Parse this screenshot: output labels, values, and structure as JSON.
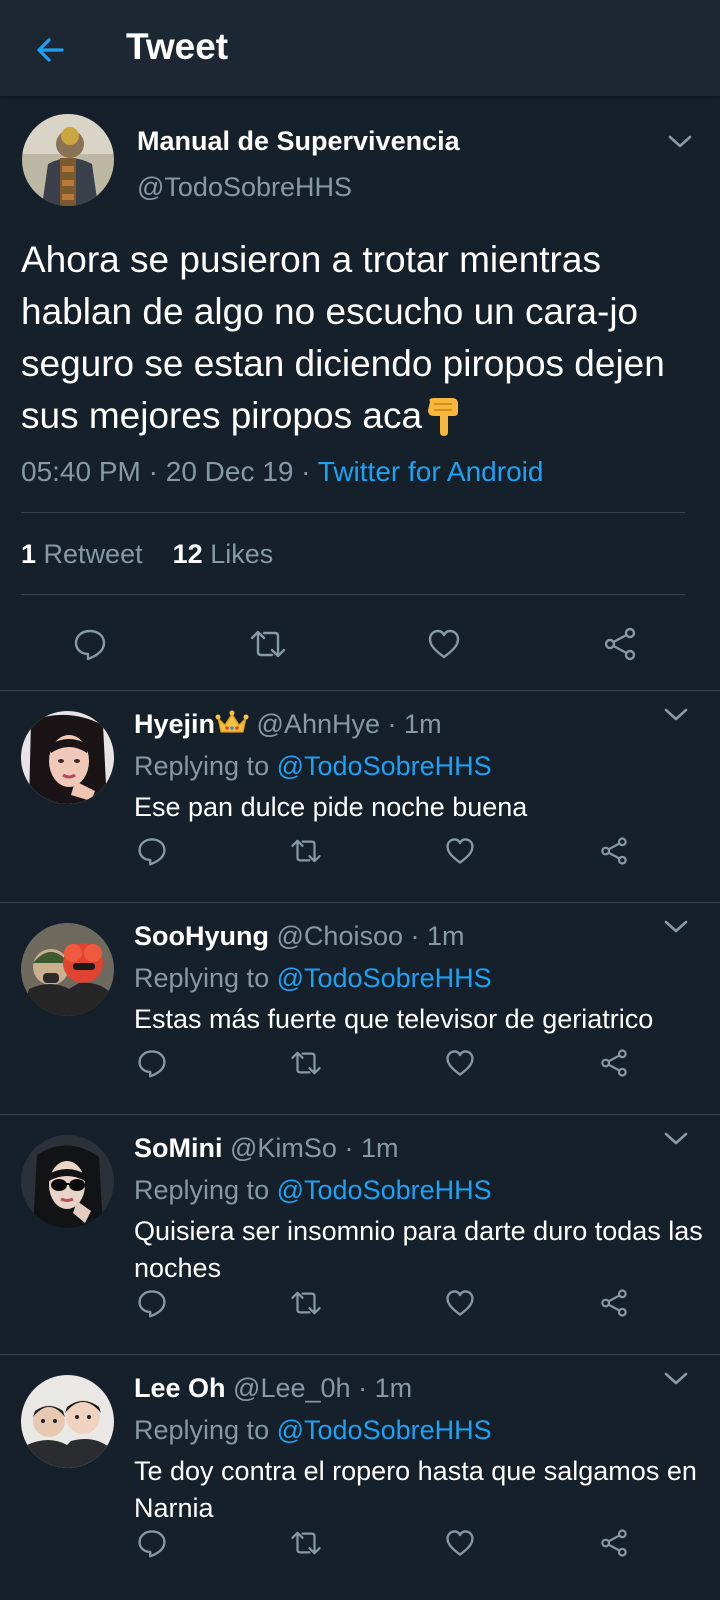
{
  "topbar": {
    "title": "Tweet"
  },
  "main_tweet": {
    "author_name": "Manual de Supervivencia",
    "author_handle": "@TodoSobreHHS",
    "text": "Ahora se pusieron a trotar mientras hablan de algo no escucho un cara-jo seguro se estan diciendo piropos dejen sus mejores piropos aca",
    "emoji": "backhand-index-pointing-down-emoji",
    "time": "05:40 PM",
    "date": "20 Dec 19",
    "separator": "·",
    "source": "Twitter for Android",
    "retweets_count": "1",
    "retweets_label": "Retweet",
    "likes_count": "12",
    "likes_label": "Likes"
  },
  "replies": [
    {
      "name": "Hyejin",
      "badge": "crown-emoji",
      "handle": "@AhnHye",
      "time": "1m",
      "replying_label": "Replying to",
      "replying_handle": "@TodoSobreHHS",
      "text": "Ese pan dulce pide noche buena"
    },
    {
      "name": "SooHyung",
      "handle": "@Choisoo",
      "time": "1m",
      "replying_label": "Replying to",
      "replying_handle": "@TodoSobreHHS",
      "text": "Estas más fuerte que televisor de geriatrico"
    },
    {
      "name": "SoMini",
      "handle": "@KimSo",
      "time": "1m",
      "replying_label": "Replying to",
      "replying_handle": "@TodoSobreHHS",
      "text": "Quisiera ser insomnio para darte duro todas las noches"
    },
    {
      "name": "Lee Oh",
      "handle": "@Lee_0h",
      "time": "1m",
      "replying_label": "Replying to",
      "replying_handle": "@TodoSobreHHS",
      "text": "Te doy contra el ropero hasta que salgamos en Narnia"
    }
  ],
  "icons": [
    "back-arrow-icon",
    "chevron-down-icon",
    "reply-icon",
    "retweet-icon",
    "like-icon",
    "share-icon"
  ],
  "colors": {
    "background": "#15202b",
    "topbar": "#1c2733",
    "accent": "#1da1f2",
    "secondary_text": "#8899a6",
    "divider": "#38444d"
  }
}
